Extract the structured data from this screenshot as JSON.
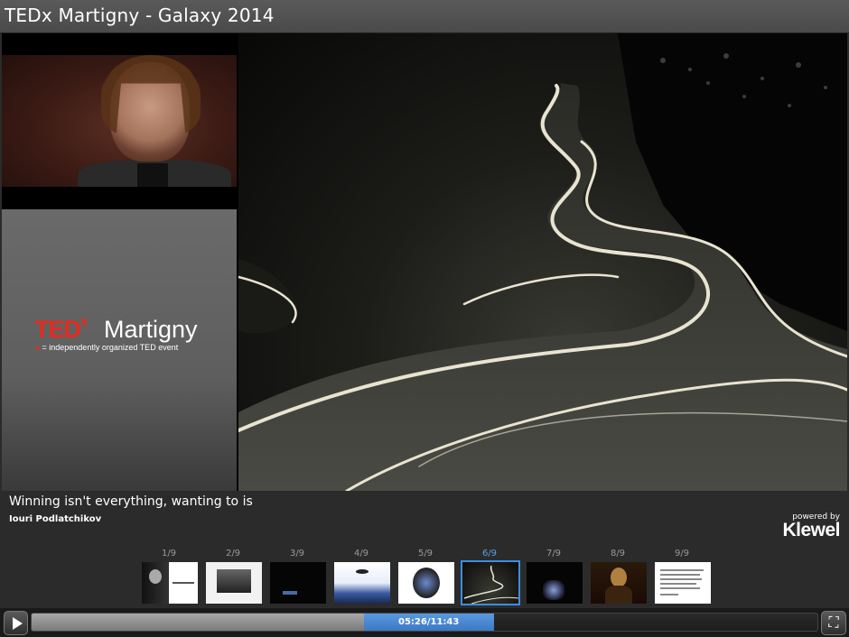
{
  "window": {
    "title": "TEDx Martigny - Galaxy 2014"
  },
  "logo": {
    "ted": "TED",
    "x": "x",
    "city": "Martigny",
    "tag_x": "x",
    "tag": " = independently organized TED event"
  },
  "slide_info": {
    "caption": "Winning isn't everything, wanting to is",
    "speaker": "Iouri Podlatchikov"
  },
  "branding": {
    "powered_by": "powered by",
    "brand": "Klewel"
  },
  "thumbnails": [
    {
      "label": "1/9",
      "active": false
    },
    {
      "label": "2/9",
      "active": false
    },
    {
      "label": "3/9",
      "active": false
    },
    {
      "label": "4/9",
      "active": false
    },
    {
      "label": "5/9",
      "active": false
    },
    {
      "label": "6/9",
      "active": true
    },
    {
      "label": "7/9",
      "active": false
    },
    {
      "label": "8/9",
      "active": false
    },
    {
      "label": "9/9",
      "active": false
    }
  ],
  "player": {
    "time_display": "05:26/11:43",
    "progress_fraction": 0.464,
    "play_icon": "play-icon",
    "fullscreen_icon": "fullscreen-icon"
  },
  "colors": {
    "ted_red": "#e62b1e",
    "accent_blue": "#3c8ee0"
  }
}
